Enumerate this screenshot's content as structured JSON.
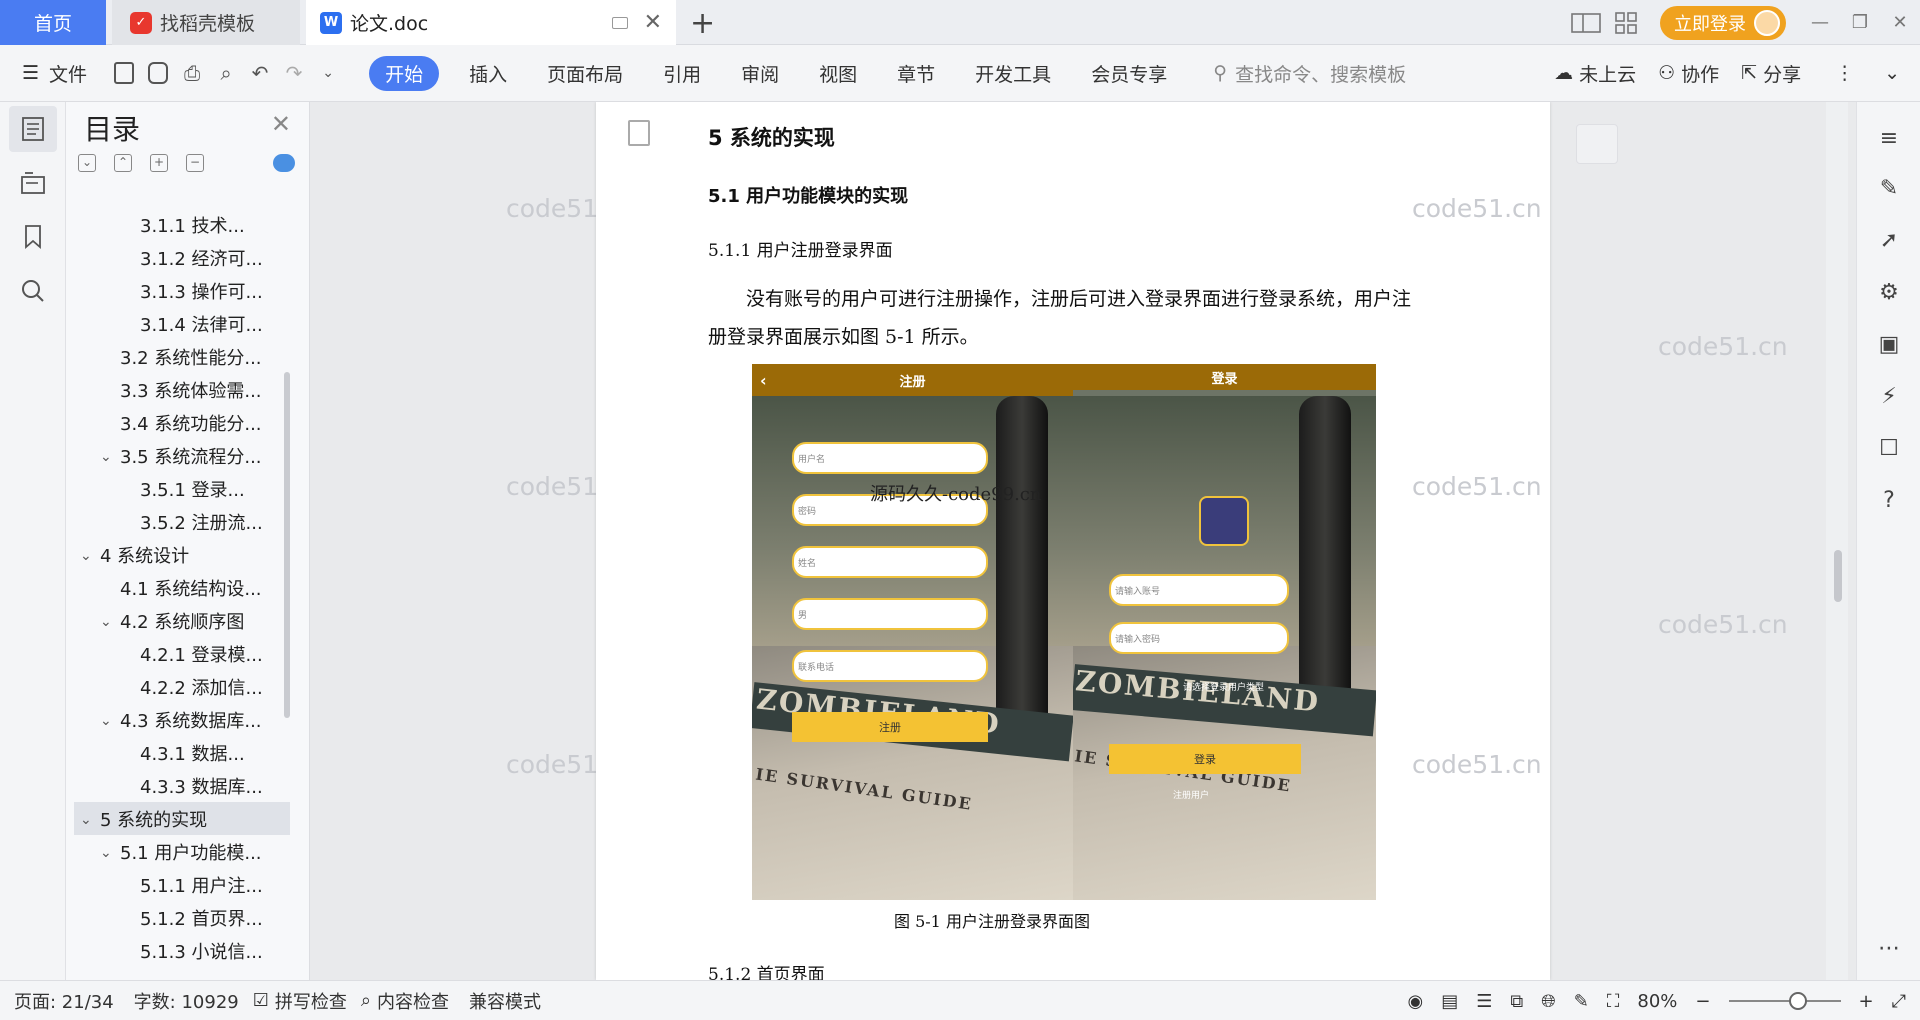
{
  "tabs": {
    "home": "首页",
    "template": "找稻壳模板",
    "doc": "论文.doc",
    "add": "+"
  },
  "titlebar": {
    "login": "立即登录"
  },
  "ribbon": {
    "file": "文件",
    "menus": [
      "开始",
      "插入",
      "页面布局",
      "引用",
      "审阅",
      "视图",
      "章节",
      "开发工具",
      "会员专享"
    ],
    "active_menu": "开始",
    "search": "查找命令、搜索模板",
    "cloud": "未上云",
    "collab": "协作",
    "share": "分享"
  },
  "toc": {
    "title": "目录",
    "items": [
      {
        "text": "3.1.1 技术...",
        "level": 3
      },
      {
        "text": "3.1.2 经济可...",
        "level": 3
      },
      {
        "text": "3.1.3 操作可...",
        "level": 3
      },
      {
        "text": "3.1.4 法律可...",
        "level": 3
      },
      {
        "text": "3.2 系统性能分...",
        "level": 2
      },
      {
        "text": "3.3  系统体验需...",
        "level": 2
      },
      {
        "text": "3.4  系统功能分...",
        "level": 2
      },
      {
        "text": "3.5 系统流程分...",
        "level": 2,
        "expand": true
      },
      {
        "text": "3.5.1  登录...",
        "level": 3
      },
      {
        "text": "3.5.2 注册流...",
        "level": 3
      },
      {
        "text": "4 系统设计",
        "level": 1,
        "expand": true
      },
      {
        "text": "4.1 系统结构设...",
        "level": 2
      },
      {
        "text": "4.2 系统顺序图",
        "level": 2,
        "expand": true
      },
      {
        "text": "4.2.1 登录模...",
        "level": 3
      },
      {
        "text": "4.2.2 添加信...",
        "level": 3
      },
      {
        "text": "4.3 系统数据库...",
        "level": 2,
        "expand": true
      },
      {
        "text": "4.3.1 数据...",
        "level": 3
      },
      {
        "text": "4.3.3 数据库...",
        "level": 3
      },
      {
        "text": "5  系统的实现",
        "level": 1,
        "expand": true,
        "selected": true
      },
      {
        "text": "5.1 用户功能模...",
        "level": 2,
        "expand": true
      },
      {
        "text": "5.1.1 用户注...",
        "level": 3
      },
      {
        "text": "5.1.2 首页界...",
        "level": 3
      },
      {
        "text": "5.1.3 小说信...",
        "level": 3
      }
    ]
  },
  "doc": {
    "h1": "5  系统的实现",
    "h2": "5.1 用户功能模块的实现",
    "h3": "5.1.1 用户注册登录界面",
    "para": "没有账号的用户可进行注册操作，注册后可进入登录界面进行登录系统，用户注册登录界面展示如图 5-1 所示。",
    "caption": "图 5-1  用户注册登录界面图",
    "h3b": "5.1.2 首页界面",
    "watermark": "code51.cn",
    "fig_watermark": "源码久久-code99.cn",
    "register": {
      "title": "注册",
      "fields": [
        "用户名",
        "密码",
        "姓名",
        "男",
        "联系电话"
      ],
      "button": "注册",
      "book_title": "ZOMBIELAND",
      "book_sub": "IE SURVIVAL GUIDE"
    },
    "login": {
      "title": "登录",
      "fields": [
        "请输入账号",
        "请输入密码"
      ],
      "role": "请选择登录用户类型",
      "button": "登录",
      "link": "注册用户",
      "book_title": "ZOMBIELAND",
      "book_sub": "IE SURVIVAL GUIDE"
    }
  },
  "status": {
    "page": "页面: 21/34",
    "words": "字数: 10929",
    "spell": "拼写检查",
    "content": "内容检查",
    "compat": "兼容模式",
    "zoom": "80%",
    "zoom_value": 0.8
  },
  "colors": {
    "accent": "#4a7cf2",
    "login": "#f0a21f",
    "phone_bar": "#9b6a07",
    "phone_button": "#f4c233"
  }
}
